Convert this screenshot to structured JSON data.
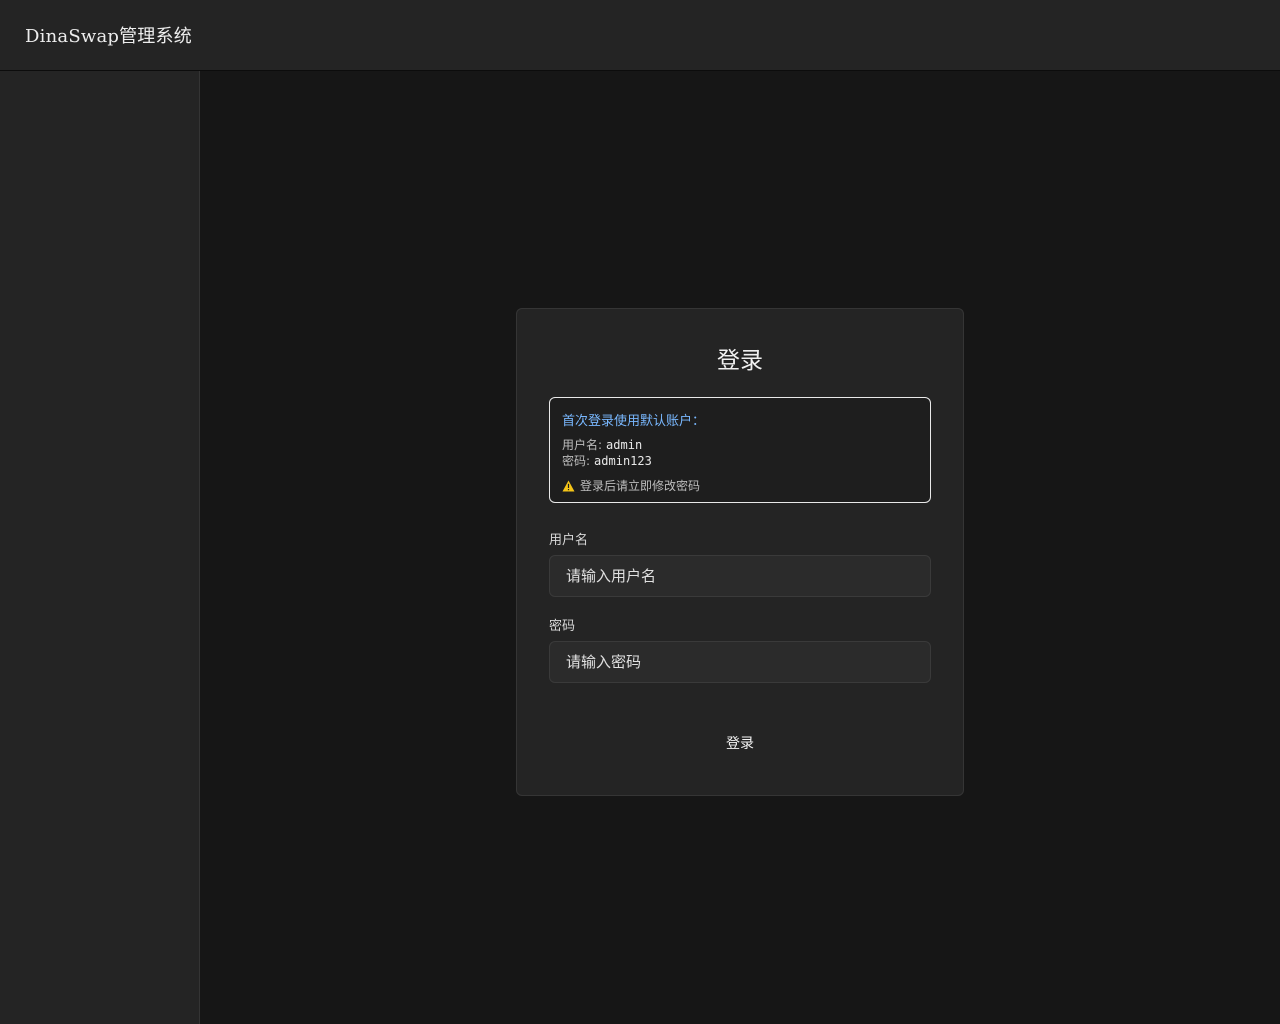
{
  "header": {
    "app_title": "DinaSwap管理系统"
  },
  "login": {
    "title": "登录",
    "notice": {
      "heading": "首次登录使用默认账户：",
      "username_label": "用户名:",
      "username_value": "admin",
      "password_label": "密码:",
      "password_value": "admin123",
      "warning_text": "登录后请立即修改密码",
      "warning_icon": "warning-icon"
    },
    "username_field": {
      "label": "用户名",
      "placeholder": "请输入用户名",
      "value": ""
    },
    "password_field": {
      "label": "密码",
      "placeholder": "请输入密码",
      "value": ""
    },
    "submit_label": "登录"
  },
  "colors": {
    "notice_heading": "#79b8ff",
    "warning": "#f5c518",
    "card_background": "#242424",
    "page_background": "#161616"
  }
}
